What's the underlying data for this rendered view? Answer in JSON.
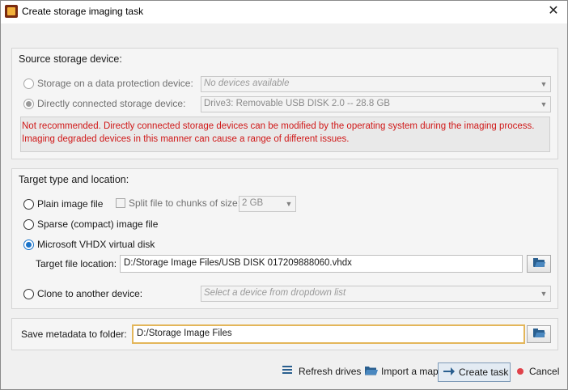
{
  "window": {
    "title": "Create storage imaging task"
  },
  "source": {
    "heading": "Source storage device:",
    "option_protection": "Storage on a data protection device:",
    "protection_value": "No devices available",
    "option_direct": "Directly connected storage device:",
    "direct_value": "Drive3: Removable USB DISK 2.0 -- 28.8 GB",
    "warning": "Not recommended. Directly connected storage devices can be modified by the operating system during the imaging process. Imaging degraded devices in this manner can cause a range of different issues."
  },
  "target": {
    "heading": "Target type and location:",
    "option_plain": "Plain image file",
    "split_label": "Split file to chunks of size:",
    "split_value": "2 GB",
    "option_sparse": "Sparse (compact) image file",
    "option_vhdx": "Microsoft VHDX virtual disk",
    "location_label": "Target file location:",
    "location_value": "D:/Storage Image Files/USB DISK 017209888060.vhdx",
    "option_clone": "Clone to another device:",
    "clone_placeholder": "Select a device from dropdown list"
  },
  "metadata": {
    "label": "Save metadata to folder:",
    "value": "D:/Storage Image Files"
  },
  "actions": {
    "refresh": "Refresh drives",
    "import": "Import a map",
    "create": "Create task",
    "cancel": "Cancel"
  },
  "icons": [
    "app-icon",
    "close-icon",
    "chevron-down-icon",
    "folder-open-icon",
    "list-icon",
    "folder-icon",
    "arrow-right-icon",
    "cancel-dot-icon"
  ],
  "colors": {
    "warning_text": "#d01818",
    "focus_border": "#e3b65a",
    "accent": "#1a73c9",
    "cancel_dot": "#e0424a"
  }
}
